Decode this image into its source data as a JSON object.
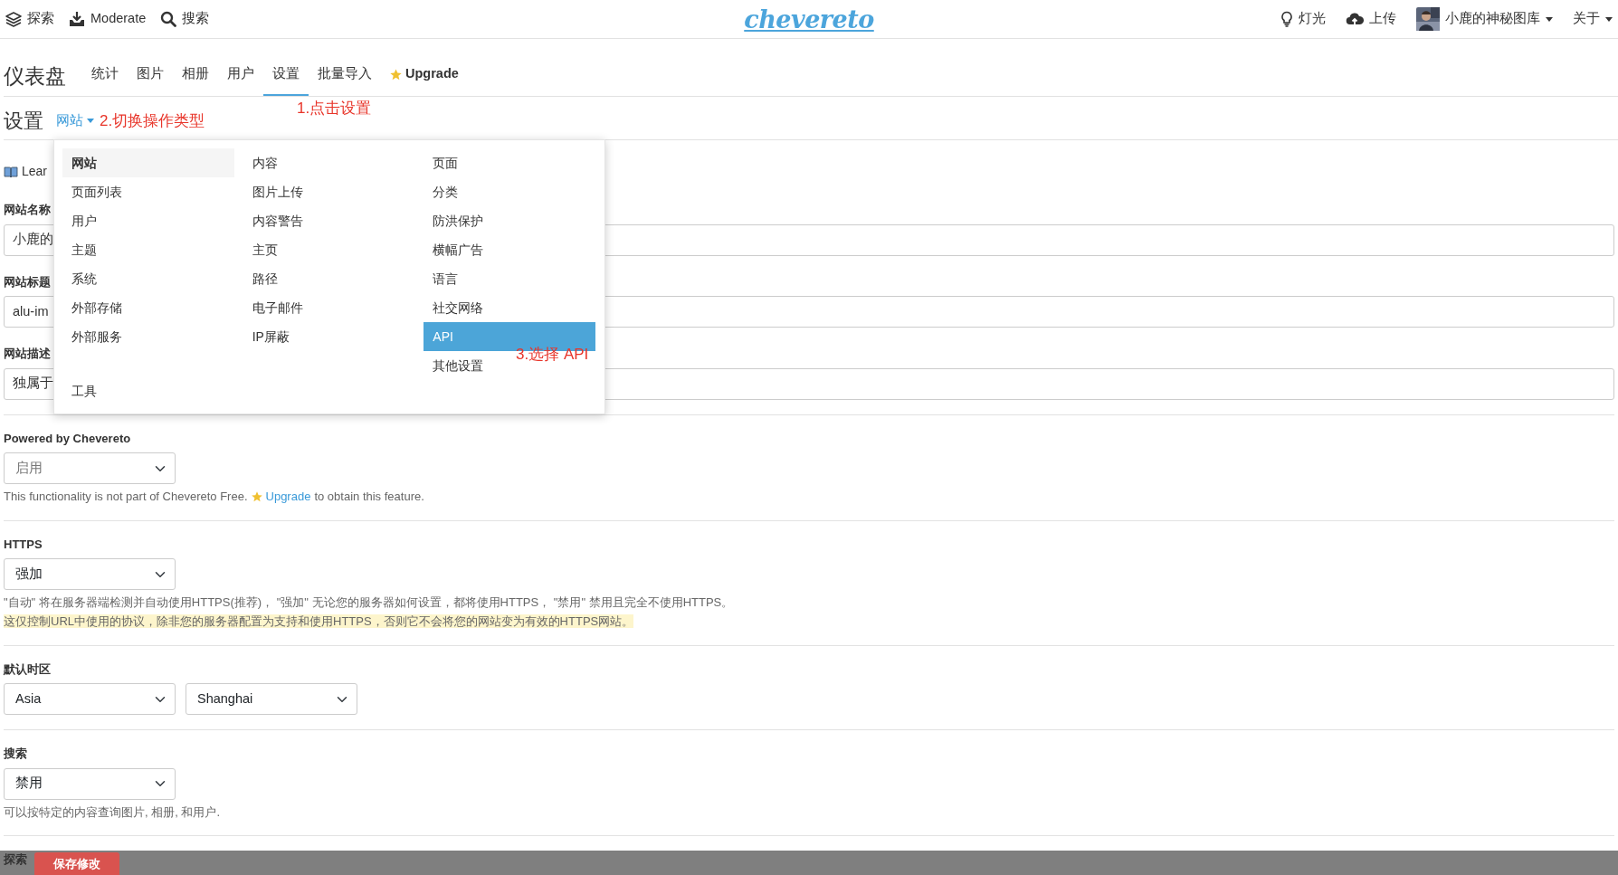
{
  "topbar": {
    "left": [
      {
        "label": "探索"
      },
      {
        "label": "Moderate"
      },
      {
        "label": "搜索"
      }
    ],
    "logo": "chevereto",
    "right": [
      {
        "label": "灯光",
        "caret": false
      },
      {
        "label": "上传",
        "caret": false
      },
      {
        "label": "小鹿的神秘图库",
        "caret": true
      },
      {
        "label": "关于",
        "caret": true
      }
    ]
  },
  "dashboard": {
    "title": "仪表盘",
    "tabs": [
      {
        "label": "统计",
        "selected": false,
        "kind": "tab"
      },
      {
        "label": "图片",
        "selected": false,
        "kind": "tab"
      },
      {
        "label": "相册",
        "selected": false,
        "kind": "tab"
      },
      {
        "label": "用户",
        "selected": false,
        "kind": "tab"
      },
      {
        "label": "设置",
        "selected": true,
        "kind": "tab"
      },
      {
        "label": "批量导入",
        "selected": false,
        "kind": "tab"
      },
      {
        "label": "Upgrade",
        "selected": false,
        "kind": "upgrade"
      }
    ],
    "note": "1.点击设置"
  },
  "settings_header": {
    "title": "设置",
    "dropdown_label": "网站",
    "note": "2.切换操作类型"
  },
  "learn": "Lear",
  "sections": [
    [
      {
        "kind": "text",
        "label": "网站名称",
        "value": "小鹿的"
      },
      {
        "kind": "text",
        "label": "网站标题",
        "value": "alu-im"
      },
      {
        "kind": "text",
        "label": "网站描述",
        "value": "独属于"
      }
    ],
    [
      {
        "kind": "select",
        "label": "Powered by Chevereto",
        "value": "启用",
        "disabled": true,
        "help": "This functionality is not part of Chevereto Free.",
        "link": "Upgrade",
        "help_after": "to obtain this feature."
      }
    ],
    [
      {
        "kind": "select",
        "label": "HTTPS",
        "value": "强加",
        "disabled": false,
        "help": "\"自动\" 将在服务器端检测并自动使用HTTPS(推荐)， \"强加\" 无论您的服务器如何设置，都将使用HTTPS， \"禁用\" 禁用且完全不使用HTTPS。",
        "note": "这仅控制URL中使用的协议，除非您的服务器配置为支持和使用HTTPS，否则它不会将您的网站变为有效的HTTPS网站。"
      }
    ],
    [
      {
        "kind": "pair",
        "label": "默认时区",
        "value": "Asia",
        "value2": "Shanghai"
      }
    ],
    [
      {
        "kind": "select",
        "label": "搜索",
        "value": "禁用",
        "disabled": false,
        "help": "可以按特定的内容查询图片, 相册, 和用户."
      }
    ],
    [
      {
        "kind": "label",
        "label": "探索"
      }
    ]
  ],
  "menu": {
    "columns": [
      [
        {
          "label": "网站",
          "selected": true,
          "kind": "item"
        },
        {
          "label": "页面列表",
          "selected": false,
          "kind": "item"
        },
        {
          "label": "用户",
          "selected": false,
          "kind": "item"
        },
        {
          "label": "主题",
          "selected": false,
          "kind": "item"
        },
        {
          "label": "系统",
          "selected": false,
          "kind": "item"
        },
        {
          "label": "外部存储",
          "selected": false,
          "kind": "item"
        },
        {
          "label": "外部服务",
          "selected": false,
          "kind": "item"
        },
        {
          "label": "工具",
          "selected": false,
          "kind": "spaced"
        }
      ],
      [
        {
          "label": "内容",
          "selected": false,
          "kind": "item"
        },
        {
          "label": "图片上传",
          "selected": false,
          "kind": "item"
        },
        {
          "label": "内容警告",
          "selected": false,
          "kind": "item"
        },
        {
          "label": "主页",
          "selected": false,
          "kind": "item"
        },
        {
          "label": "路径",
          "selected": false,
          "kind": "item"
        },
        {
          "label": "电子邮件",
          "selected": false,
          "kind": "item"
        },
        {
          "label": "IP屏蔽",
          "selected": false,
          "kind": "item"
        }
      ],
      [
        {
          "label": "页面",
          "selected": false,
          "kind": "item"
        },
        {
          "label": "分类",
          "selected": false,
          "kind": "item"
        },
        {
          "label": "防洪保护",
          "selected": false,
          "kind": "item"
        },
        {
          "label": "横幅广告",
          "selected": false,
          "kind": "item"
        },
        {
          "label": "语言",
          "selected": false,
          "kind": "item"
        },
        {
          "label": "社交网络",
          "selected": false,
          "kind": "item"
        },
        {
          "label": "API",
          "selected": false,
          "highlighted": true,
          "kind": "item"
        },
        {
          "label": "其他设置",
          "selected": false,
          "kind": "item"
        }
      ]
    ],
    "note": "3.选择 API"
  },
  "save_button": "保存修改"
}
